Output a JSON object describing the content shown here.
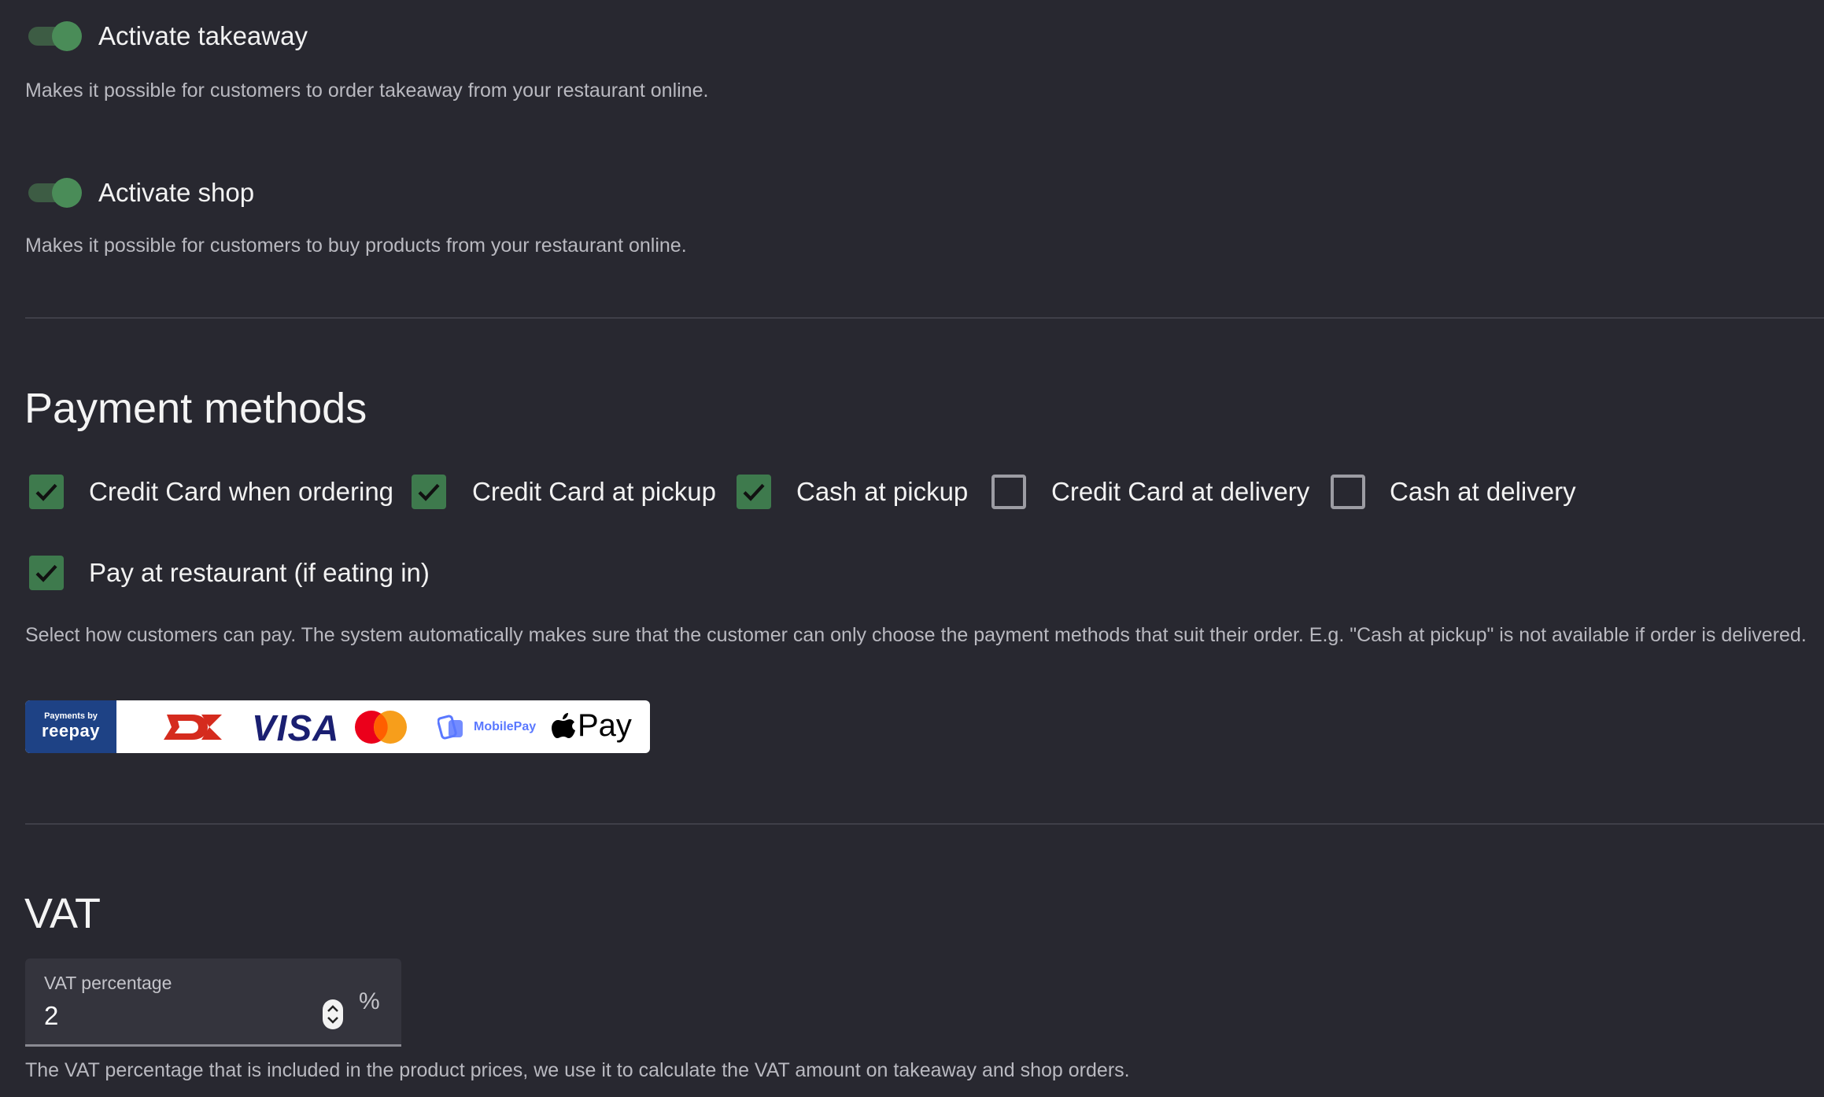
{
  "takeaway": {
    "label": "Activate takeaway",
    "description": "Makes it possible for customers to order takeaway from your restaurant online.",
    "enabled": true
  },
  "shop": {
    "label": "Activate shop",
    "description": "Makes it possible for customers to buy products from your restaurant online.",
    "enabled": true
  },
  "payment": {
    "title": "Payment methods",
    "methods": [
      {
        "label": "Credit Card when ordering",
        "checked": true
      },
      {
        "label": "Credit Card at pickup",
        "checked": true
      },
      {
        "label": "Cash at pickup",
        "checked": true
      },
      {
        "label": "Credit Card at delivery",
        "checked": false
      },
      {
        "label": "Cash at delivery",
        "checked": false
      },
      {
        "label": "Pay at restaurant (if eating in)",
        "checked": true
      }
    ],
    "description": "Select how customers can pay. The system automatically makes sure that the customer can only choose the payment methods that suit their order. E.g. \"Cash at pickup\" is not available if order is delivered.",
    "logos": {
      "reepay_small": "Payments by",
      "reepay_big": "reepay",
      "visa": "VISA",
      "mobilepay": "MobilePay",
      "applepay": "Pay"
    }
  },
  "vat": {
    "title": "VAT",
    "field_label": "VAT percentage",
    "value": "2",
    "unit": "%",
    "description": "The VAT percentage that is included in the product prices, we use it to calculate the VAT amount on takeaway and shop orders."
  },
  "colors": {
    "background": "#282830",
    "accent": "#4a8c58",
    "checkbox_checked": "#3e7a4d"
  }
}
